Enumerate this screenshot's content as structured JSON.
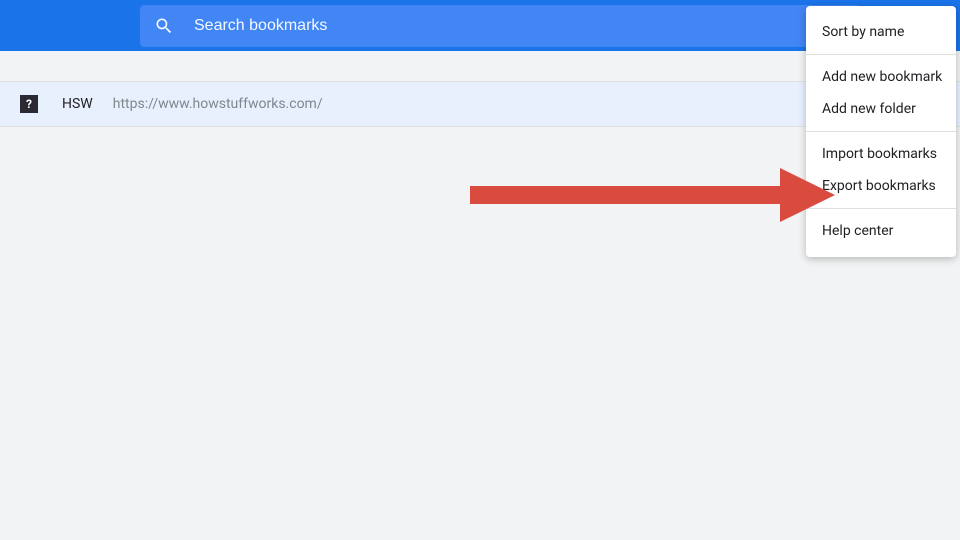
{
  "search": {
    "placeholder": "Search bookmarks"
  },
  "bookmark": {
    "favicon_text": "?",
    "title": "HSW",
    "url": "https://www.howstuffworks.com/"
  },
  "menu": {
    "sort_by_name": "Sort by name",
    "add_new_bookmark": "Add new bookmark",
    "add_new_folder": "Add new folder",
    "import_bookmarks": "Import bookmarks",
    "export_bookmarks": "Export bookmarks",
    "help_center": "Help center"
  },
  "colors": {
    "header_blue": "#1a73e8",
    "search_blue": "#4285f4",
    "row_highlight": "#e8f0fe",
    "arrow": "#d94a3f"
  }
}
